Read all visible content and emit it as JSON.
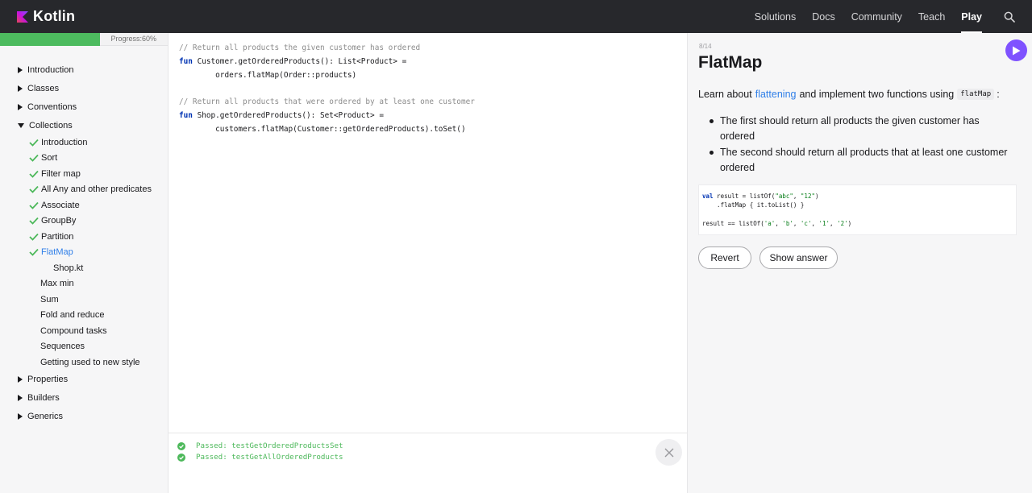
{
  "header": {
    "brand": "Kotlin",
    "nav": [
      "Solutions",
      "Docs",
      "Community",
      "Teach",
      "Play"
    ],
    "active_nav": "Play",
    "colors": {
      "bar": "#27282c",
      "brand": "#7f52ff"
    }
  },
  "sidebar": {
    "progress_label": "Progress:60%",
    "progress_fraction": 0.6,
    "items": [
      {
        "label": "Introduction",
        "kind": "section"
      },
      {
        "label": "Classes",
        "kind": "section"
      },
      {
        "label": "Conventions",
        "kind": "section"
      },
      {
        "label": "Collections",
        "kind": "section-open"
      },
      {
        "label": "Introduction",
        "kind": "done"
      },
      {
        "label": "Sort",
        "kind": "done"
      },
      {
        "label": "Filter map",
        "kind": "done"
      },
      {
        "label": "All Any and other predicates",
        "kind": "done"
      },
      {
        "label": "Associate",
        "kind": "done"
      },
      {
        "label": "GroupBy",
        "kind": "done"
      },
      {
        "label": "Partition",
        "kind": "done"
      },
      {
        "label": "FlatMap",
        "kind": "current"
      },
      {
        "label": "Shop.kt",
        "kind": "file"
      },
      {
        "label": "Max min",
        "kind": "pending"
      },
      {
        "label": "Sum",
        "kind": "pending"
      },
      {
        "label": "Fold and reduce",
        "kind": "pending"
      },
      {
        "label": "Compound tasks",
        "kind": "pending"
      },
      {
        "label": "Sequences",
        "kind": "pending"
      },
      {
        "label": "Getting used to new style",
        "kind": "pending"
      },
      {
        "label": "Properties",
        "kind": "section"
      },
      {
        "label": "Builders",
        "kind": "section"
      },
      {
        "label": "Generics",
        "kind": "section"
      }
    ]
  },
  "editor": {
    "line1": "// Return all products the given customer has ordered",
    "line2_kw": "fun",
    "line2": " Customer.getOrderedProducts(): List<Product> =",
    "line3": "        orders.flatMap(Order::products)",
    "line4": "",
    "line5": "// Return all products that were ordered by at least one customer",
    "line6_kw": "fun",
    "line6": " Shop.getOrderedProducts(): Set<Product> =",
    "line7": "        customers.flatMap(Customer::getOrderedProducts).toSet()"
  },
  "console": {
    "results": [
      "Passed: testGetOrderedProductsSet",
      "Passed: testGetAllOrderedProducts"
    ]
  },
  "task": {
    "count": "8/14",
    "title": "FlatMap",
    "intro_before": "Learn about",
    "intro_link": "flattening",
    "intro_middle": "and implement two functions using",
    "intro_code": "flatMap",
    "intro_after": ":",
    "bullets": [
      "The first should return all products the given customer has ordered",
      "The second should return all products that at least one customer ordered"
    ],
    "sample": {
      "l1_kw": "val",
      "l1_a": " result = listOf(",
      "l1_s1": "\"abc\"",
      "l1_b": ", ",
      "l1_s2": "\"12\"",
      "l1_c": ")",
      "l2": "    .flatMap { it.toList() }",
      "l4_a": "result == listOf(",
      "l4_s1": "'a'",
      "l4_s2": "'b'",
      "l4_s3": "'c'",
      "l4_s4": "'1'",
      "l4_s5": "'2'",
      "l4_sep": ", ",
      "l4_end": ")"
    },
    "revert_label": "Revert",
    "show_answer_label": "Show answer"
  }
}
